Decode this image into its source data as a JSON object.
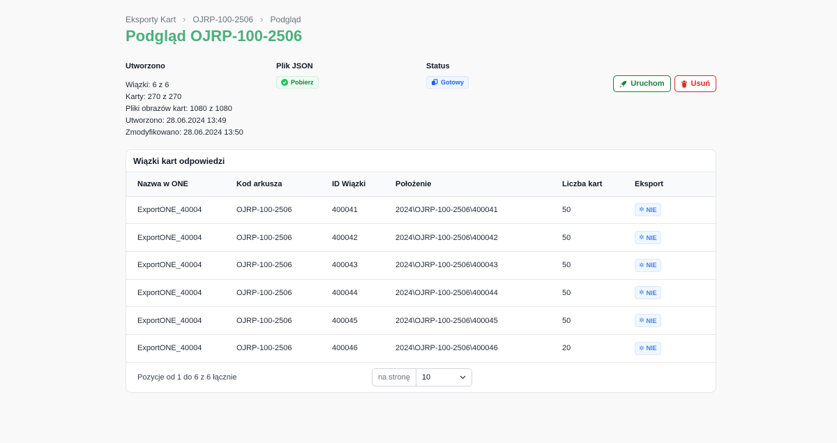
{
  "breadcrumb": [
    "Eksporty Kart",
    "OJRP-100-2506",
    "Podgląd"
  ],
  "page_title": "Podgląd OJRP-100-2506",
  "meta": {
    "created_label": "Utworzono",
    "lines": [
      "Wiązki: 6 z 6",
      "Karty: 270 z 270",
      "Pliki obrazów kart: 1080 z 1080",
      "Utworzono: 28.06.2024 13:49",
      "Zmodyfikowano: 28.06.2024 13:50"
    ],
    "json_label": "Plik JSON",
    "json_badge": "Pobierz",
    "status_label": "Status",
    "status_badge": "Gotowy"
  },
  "actions": {
    "run": "Uruchom",
    "delete": "Usuń"
  },
  "table": {
    "title": "Wiązki kart odpowiedzi",
    "headers": [
      "Nazwa w ONE",
      "Kod arkusza",
      "ID Wiązki",
      "Położenie",
      "Liczba kart",
      "Eksport"
    ],
    "rows": [
      [
        "ExportONE_40004",
        "OJRP-100-2506",
        "400041",
        "2024\\OJRP-100-2506\\400041",
        "50",
        "NIE"
      ],
      [
        "ExportONE_40004",
        "OJRP-100-2506",
        "400042",
        "2024\\OJRP-100-2506\\400042",
        "50",
        "NIE"
      ],
      [
        "ExportONE_40004",
        "OJRP-100-2506",
        "400043",
        "2024\\OJRP-100-2506\\400043",
        "50",
        "NIE"
      ],
      [
        "ExportONE_40004",
        "OJRP-100-2506",
        "400044",
        "2024\\OJRP-100-2506\\400044",
        "50",
        "NIE"
      ],
      [
        "ExportONE_40004",
        "OJRP-100-2506",
        "400045",
        "2024\\OJRP-100-2506\\400045",
        "50",
        "NIE"
      ],
      [
        "ExportONE_40004",
        "OJRP-100-2506",
        "400046",
        "2024\\OJRP-100-2506\\400046",
        "20",
        "NIE"
      ]
    ],
    "footer_text": "Pozycje od 1 do 6 z 6 łącznie",
    "per_page_label": "na stronę",
    "per_page_value": "10"
  },
  "colors": {
    "title": "#4caf7d",
    "run": "#15803d",
    "delete": "#dc2626",
    "badge_blue": "#3b82f6"
  },
  "icons": {
    "json": "check-circle-icon",
    "status": "copy-icon",
    "run": "rocket-icon",
    "delete": "trash-icon",
    "export": "snowflake-icon"
  }
}
